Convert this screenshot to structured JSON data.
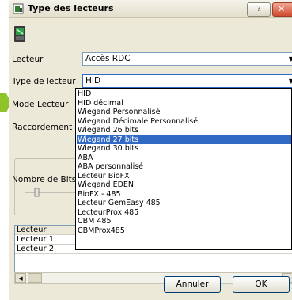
{
  "window": {
    "title": "Type des lecteurs",
    "help_label": "?",
    "close_label": "✕",
    "title_icon": "reader-icon",
    "large_icon": "reader-device-icon"
  },
  "colors": {
    "selection": "#316ac5",
    "dialog_bg": "#ece9d8",
    "accent_arrow": "#8fc22b"
  },
  "form": {
    "lecteur_label": "Lecteur",
    "lecteur_value": "Accès RDC",
    "type_label": "Type de lecteur",
    "type_value": "HID",
    "mode_label": "Mode Lecteur",
    "raccordement_label": "Raccordement",
    "bits_label": "Nombre de Bits (16"
  },
  "dropdown": {
    "selected_index": 5,
    "options": [
      "HID",
      "HID décimal",
      "Wiegand Personnalisé",
      "Wiegand Décimale Personnalisé",
      "Wiegand 26 bits",
      "Wiegand 27 bits",
      "Wiegand 30 bits",
      "ABA",
      "ABA personnalisé",
      "Lecteur BioFX",
      "Wiegand EDEN",
      "BioFX - 485",
      "Lecteur GemEasy 485",
      "LecteurProx 485",
      "CBM 485",
      "CBMProx485"
    ]
  },
  "grid": {
    "header": "Lecteur",
    "rows": [
      "Lecteur 1",
      "Lecteur 2"
    ]
  },
  "buttons": {
    "cancel": "Annuler",
    "ok": "OK"
  }
}
